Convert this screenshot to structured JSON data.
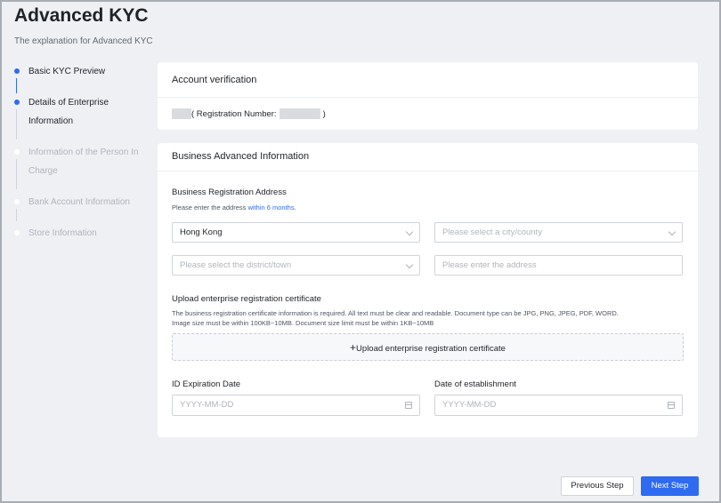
{
  "page": {
    "title": "Advanced KYC",
    "subtitle": "The explanation for Advanced KYC"
  },
  "steps": [
    {
      "label_lines": [
        "Basic KYC Preview"
      ],
      "state": "done"
    },
    {
      "label_lines": [
        "Details of Enterprise",
        "Information"
      ],
      "state": "active"
    },
    {
      "label_lines": [
        "Information of the Person In",
        "Charge"
      ],
      "state": "pending"
    },
    {
      "label_lines": [
        "Bank Account Information"
      ],
      "state": "pending"
    },
    {
      "label_lines": [
        "Store Information"
      ],
      "state": "pending"
    }
  ],
  "account_verification": {
    "title": "Account verification",
    "reg_prefix": "( Registration Number:",
    "reg_suffix": ")"
  },
  "business_info": {
    "title": "Business Advanced Information",
    "address_label": "Business Registration Address",
    "address_hint": "Please enter the address ",
    "address_hint_link": "within 6 months.",
    "country_value": "Hong Kong",
    "city_placeholder": "Please select a city/county",
    "district_placeholder": "Please select the district/town",
    "address_placeholder": "Please enter the address",
    "upload_label": "Upload enterprise registration certificate",
    "upload_hint_1": "The business registration certificate information is required. All text must be clear and readable. Document type can be JPG, PNG, JPEG, PDF, WORD.",
    "upload_hint_2": "Image size must be within 100KB~10MB. Document size limit must be within 1KB~10MB",
    "upload_plus": "+",
    "upload_button": "Upload enterprise registration certificate",
    "id_expiration_label": "ID Expiration Date",
    "establishment_label": "Date of establishment",
    "date_placeholder": "YYYY-MM-DD"
  },
  "actions": {
    "previous": "Previous Step",
    "next": "Next Step"
  },
  "colors": {
    "accent": "#2f6bf0",
    "background": "#eef0f4"
  }
}
